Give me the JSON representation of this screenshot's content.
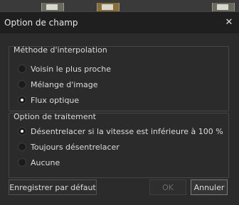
{
  "dialog": {
    "title": "Option de champ",
    "close_icon": "close-icon"
  },
  "interpolation": {
    "title": "Méthode d'interpolation",
    "options": [
      {
        "label": "Voisin le plus proche",
        "selected": false
      },
      {
        "label": "Mélange d'image",
        "selected": false
      },
      {
        "label": "Flux optique",
        "selected": true
      }
    ]
  },
  "processing": {
    "title": "Option de traitement",
    "options": [
      {
        "label": "Désentrelacer si la vitesse est inférieure à 100 %",
        "selected": true
      },
      {
        "label": "Toujours désentrelacer",
        "selected": false
      },
      {
        "label": "Aucune",
        "selected": false
      }
    ]
  },
  "buttons": {
    "save_default": "Enregistrer par défaut",
    "ok": "OK",
    "cancel": "Annuler"
  }
}
